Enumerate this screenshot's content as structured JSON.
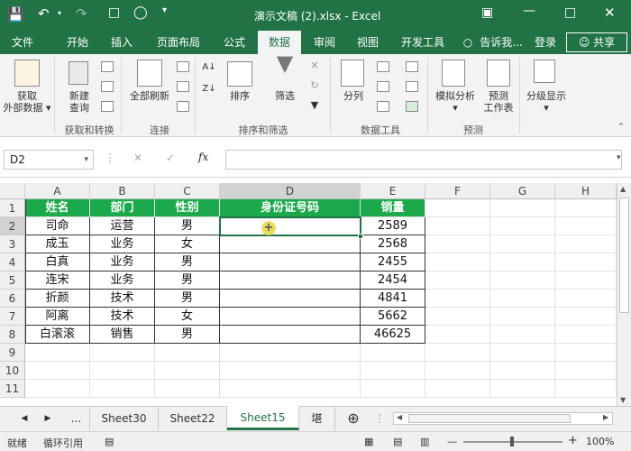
{
  "title": "演示文稿 (2).xlsx - Excel",
  "tabs": [
    "文件",
    "开始",
    "插入",
    "页面布局",
    "公式",
    "数据",
    "审阅",
    "视图",
    "开发工具",
    "告诉我...",
    "登录",
    "共享"
  ],
  "ribbon": {
    "get_data": "获取\n外部数据",
    "new_query": "新建\n查询",
    "refresh_all": "全部刷新",
    "sort": "排序",
    "filter": "筛选",
    "text_to_columns": "分列",
    "what_if": "模拟分析",
    "forecast_sheet": "预测\n工作表",
    "outline": "分级显示",
    "groups": [
      "获取和转换",
      "连接",
      "排序和筛选",
      "数据工具",
      "预测"
    ]
  },
  "name_box": "D2",
  "formula": "",
  "columns": [
    "A",
    "B",
    "C",
    "D",
    "E",
    "F",
    "G",
    "H"
  ],
  "rows": [
    "1",
    "2",
    "3",
    "4",
    "5",
    "6",
    "7",
    "8",
    "9",
    "10",
    "11"
  ],
  "table": {
    "headers": [
      "姓名",
      "部门",
      "性别",
      "身份证号码",
      "销量"
    ],
    "data": [
      [
        "司命",
        "运营",
        "男",
        "",
        "2589"
      ],
      [
        "成玉",
        "业务",
        "女",
        "",
        "2568"
      ],
      [
        "白真",
        "业务",
        "男",
        "",
        "2455"
      ],
      [
        "连宋",
        "业务",
        "男",
        "",
        "2454"
      ],
      [
        "折颜",
        "技术",
        "男",
        "",
        "4841"
      ],
      [
        "阿离",
        "技术",
        "女",
        "",
        "5662"
      ],
      [
        "白滚滚",
        "销售",
        "男",
        "",
        "46625"
      ]
    ]
  },
  "sheets": [
    "...",
    "Sheet30",
    "Sheet22",
    "Sheet15",
    "堪"
  ],
  "active_sheet": "Sheet15",
  "status": {
    "ready": "就绪",
    "circular": "循环引用",
    "zoom": "100%"
  }
}
